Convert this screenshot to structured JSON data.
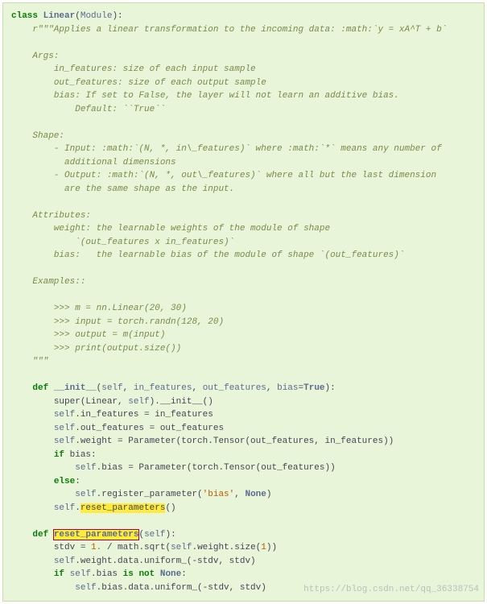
{
  "code": {
    "kw_class": "class",
    "class_name": "Linear",
    "base_class": "Module",
    "doc_open": "r\"\"\"Applies a linear transformation to the incoming data: :math:`y = xA^T + b`",
    "doc_args_title": "Args:",
    "doc_arg1": "in_features: size of each input sample",
    "doc_arg2": "out_features: size of each output sample",
    "doc_arg3a": "bias: If set to False, the layer will not learn an additive bias.",
    "doc_arg3b": "Default: ``True``",
    "doc_shape_title": "Shape:",
    "doc_shape_in1": "- Input: :math:`(N, *, in\\_features)` where :math:`*` means any number of",
    "doc_shape_in2": "additional dimensions",
    "doc_shape_out1": "- Output: :math:`(N, *, out\\_features)` where all but the last dimension",
    "doc_shape_out2": "are the same shape as the input.",
    "doc_attr_title": "Attributes:",
    "doc_attr_w1": "weight: the learnable weights of the module of shape",
    "doc_attr_w2": "`(out_features x in_features)`",
    "doc_attr_b": "bias:   the learnable bias of the module of shape `(out_features)`",
    "doc_ex_title": "Examples::",
    "doc_ex1": ">>> m = nn.Linear(20, 30)",
    "doc_ex2": ">>> input = torch.randn(128, 20)",
    "doc_ex3": ">>> output = m(input)",
    "doc_ex4": ">>> print(output.size())",
    "doc_close": "\"\"\"",
    "kw_def": "def",
    "fn_init": "__init__",
    "init_sig_self": "self",
    "init_sig_p1": "in_features",
    "init_sig_p2": "out_features",
    "init_sig_p3": "bias",
    "init_sig_p3_default": "True",
    "init_body1_a": "super(Linear, ",
    "init_body1_b": "self",
    "init_body1_c": ").__init__()",
    "init_body2_a": "self",
    "init_body2_b": ".in_features = in_features",
    "init_body3_a": "self",
    "init_body3_b": ".out_features = out_features",
    "init_body4_a": "self",
    "init_body4_b": ".weight = Parameter(torch.Tensor(out_features, in_features))",
    "kw_if": "if",
    "if_cond": "bias:",
    "if_body_a": "self",
    "if_body_b": ".bias = Parameter(torch.Tensor(out_features))",
    "kw_else": "else",
    "else_body_a": "self",
    "else_body_b": ".register_parameter(",
    "else_body_str": "'bias'",
    "else_body_c": ", ",
    "else_body_none": "None",
    "else_body_d": ")",
    "init_tail_a": "self",
    "init_tail_b": ".",
    "init_tail_hl": "reset_parameters",
    "init_tail_c": "()",
    "fn_reset": "reset_parameters",
    "reset_sig_self": "self",
    "reset_b1_a": "stdv = ",
    "reset_b1_num": "1.",
    "reset_b1_b": " / math.sqrt(",
    "reset_b1_c": "self",
    "reset_b1_d": ".weight.size(",
    "reset_b1_num2": "1",
    "reset_b1_e": "))",
    "reset_b2_a": "self",
    "reset_b2_b": ".weight.data.uniform_(-stdv, stdv)",
    "reset_if_a": "self",
    "reset_if_b": ".bias ",
    "kw_isnot": "is not",
    "reset_if_none": "None",
    "reset_if_c": ":",
    "reset_b3_a": "self",
    "reset_b3_b": ".bias.data.uniform_(-stdv, stdv)"
  },
  "watermark": "https://blog.csdn.net/qq_36338754"
}
